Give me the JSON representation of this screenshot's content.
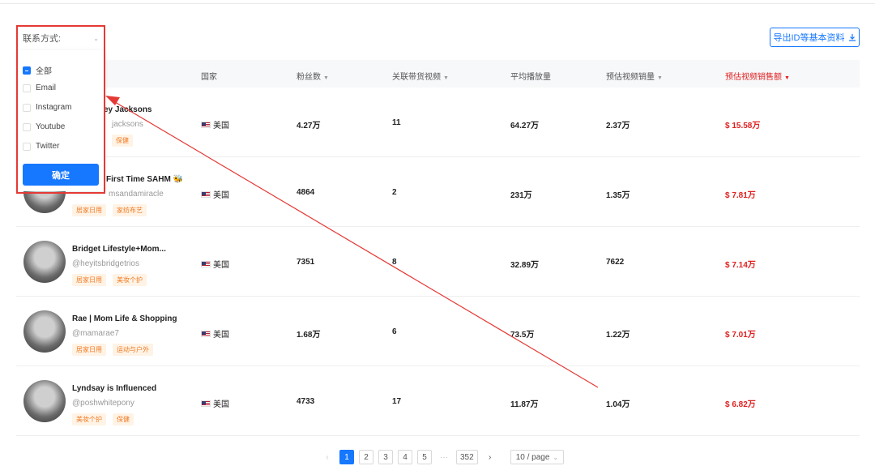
{
  "filter": {
    "label": "联系方式:"
  },
  "export_button": {
    "label": "导出ID等基本资料",
    "icon": "download-icon"
  },
  "table": {
    "headers": {
      "country": "国家",
      "followers": "粉丝数",
      "linked_videos": "关联带货视频",
      "avg_views": "平均播放量",
      "est_sales": "预估视频销量",
      "est_revenue": "预估视频销售额"
    },
    "rows": [
      {
        "name": "rney Jacksons",
        "handle": "jacksons",
        "tags": [
          "保健"
        ],
        "country": "美国",
        "followers": "4.27万",
        "linked_videos": "11",
        "avg_views": "64.27万",
        "est_sales": "2.37万",
        "est_revenue": "$ 15.58万"
      },
      {
        "name": "First Time SAHM 🐝",
        "handle": "msandamiracle",
        "tags": [
          "居家日用",
          "家纺布艺"
        ],
        "country": "美国",
        "followers": "4864",
        "linked_videos": "2",
        "avg_views": "231万",
        "est_sales": "1.35万",
        "est_revenue": "$ 7.81万"
      },
      {
        "name": "Bridget Lifestyle+Mom...",
        "handle": "@heyitsbridgetrios",
        "tags": [
          "居家日用",
          "美妆个护"
        ],
        "country": "美国",
        "followers": "7351",
        "linked_videos": "8",
        "avg_views": "32.89万",
        "est_sales": "7622",
        "est_revenue": "$ 7.14万"
      },
      {
        "name": "Rae | Mom Life & Shopping",
        "handle": "@mamarae7",
        "tags": [
          "居家日用",
          "运动与户外"
        ],
        "country": "美国",
        "followers": "1.68万",
        "linked_videos": "6",
        "avg_views": "73.5万",
        "est_sales": "1.22万",
        "est_revenue": "$ 7.01万"
      },
      {
        "name": "Lyndsay is Influenced",
        "handle": "@poshwhitepony",
        "tags": [
          "美妆个护",
          "保健"
        ],
        "country": "美国",
        "followers": "4733",
        "linked_videos": "17",
        "avg_views": "11.87万",
        "est_sales": "1.04万",
        "est_revenue": "$ 6.82万"
      }
    ]
  },
  "dropdown": {
    "options": [
      {
        "label": "全部",
        "checked": true
      },
      {
        "label": "Email",
        "checked": false
      },
      {
        "label": "Instagram",
        "checked": false
      },
      {
        "label": "Youtube",
        "checked": false
      },
      {
        "label": "Twitter",
        "checked": false
      }
    ],
    "confirm_label": "确定"
  },
  "pagination": {
    "pages": [
      "1",
      "2",
      "3",
      "4",
      "5"
    ],
    "ellipsis": "···",
    "last_page": "352",
    "current": "1",
    "page_size": "10 / page"
  },
  "colors": {
    "accent": "#1677ff",
    "highlight": "#e53935",
    "money": "#e02020",
    "tag_text": "#f07a22",
    "tag_bg": "#fff3e6"
  }
}
